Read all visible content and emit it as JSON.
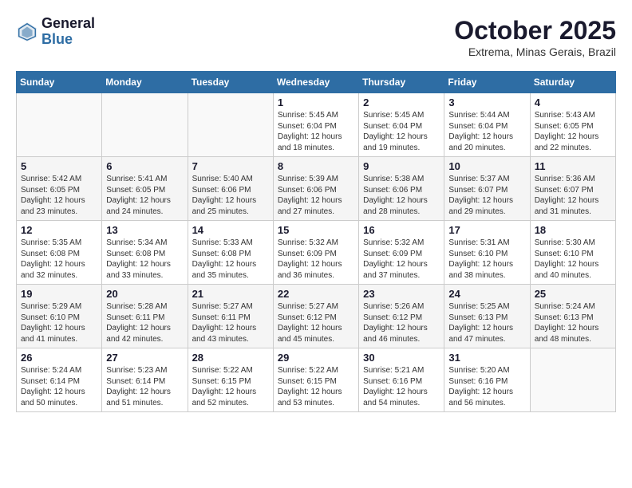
{
  "header": {
    "logo_line1": "General",
    "logo_line2": "Blue",
    "month": "October 2025",
    "location": "Extrema, Minas Gerais, Brazil"
  },
  "days_of_week": [
    "Sunday",
    "Monday",
    "Tuesday",
    "Wednesday",
    "Thursday",
    "Friday",
    "Saturday"
  ],
  "weeks": [
    [
      {
        "day": "",
        "info": ""
      },
      {
        "day": "",
        "info": ""
      },
      {
        "day": "",
        "info": ""
      },
      {
        "day": "1",
        "info": "Sunrise: 5:45 AM\nSunset: 6:04 PM\nDaylight: 12 hours\nand 18 minutes."
      },
      {
        "day": "2",
        "info": "Sunrise: 5:45 AM\nSunset: 6:04 PM\nDaylight: 12 hours\nand 19 minutes."
      },
      {
        "day": "3",
        "info": "Sunrise: 5:44 AM\nSunset: 6:04 PM\nDaylight: 12 hours\nand 20 minutes."
      },
      {
        "day": "4",
        "info": "Sunrise: 5:43 AM\nSunset: 6:05 PM\nDaylight: 12 hours\nand 22 minutes."
      }
    ],
    [
      {
        "day": "5",
        "info": "Sunrise: 5:42 AM\nSunset: 6:05 PM\nDaylight: 12 hours\nand 23 minutes."
      },
      {
        "day": "6",
        "info": "Sunrise: 5:41 AM\nSunset: 6:05 PM\nDaylight: 12 hours\nand 24 minutes."
      },
      {
        "day": "7",
        "info": "Sunrise: 5:40 AM\nSunset: 6:06 PM\nDaylight: 12 hours\nand 25 minutes."
      },
      {
        "day": "8",
        "info": "Sunrise: 5:39 AM\nSunset: 6:06 PM\nDaylight: 12 hours\nand 27 minutes."
      },
      {
        "day": "9",
        "info": "Sunrise: 5:38 AM\nSunset: 6:06 PM\nDaylight: 12 hours\nand 28 minutes."
      },
      {
        "day": "10",
        "info": "Sunrise: 5:37 AM\nSunset: 6:07 PM\nDaylight: 12 hours\nand 29 minutes."
      },
      {
        "day": "11",
        "info": "Sunrise: 5:36 AM\nSunset: 6:07 PM\nDaylight: 12 hours\nand 31 minutes."
      }
    ],
    [
      {
        "day": "12",
        "info": "Sunrise: 5:35 AM\nSunset: 6:08 PM\nDaylight: 12 hours\nand 32 minutes."
      },
      {
        "day": "13",
        "info": "Sunrise: 5:34 AM\nSunset: 6:08 PM\nDaylight: 12 hours\nand 33 minutes."
      },
      {
        "day": "14",
        "info": "Sunrise: 5:33 AM\nSunset: 6:08 PM\nDaylight: 12 hours\nand 35 minutes."
      },
      {
        "day": "15",
        "info": "Sunrise: 5:32 AM\nSunset: 6:09 PM\nDaylight: 12 hours\nand 36 minutes."
      },
      {
        "day": "16",
        "info": "Sunrise: 5:32 AM\nSunset: 6:09 PM\nDaylight: 12 hours\nand 37 minutes."
      },
      {
        "day": "17",
        "info": "Sunrise: 5:31 AM\nSunset: 6:10 PM\nDaylight: 12 hours\nand 38 minutes."
      },
      {
        "day": "18",
        "info": "Sunrise: 5:30 AM\nSunset: 6:10 PM\nDaylight: 12 hours\nand 40 minutes."
      }
    ],
    [
      {
        "day": "19",
        "info": "Sunrise: 5:29 AM\nSunset: 6:10 PM\nDaylight: 12 hours\nand 41 minutes."
      },
      {
        "day": "20",
        "info": "Sunrise: 5:28 AM\nSunset: 6:11 PM\nDaylight: 12 hours\nand 42 minutes."
      },
      {
        "day": "21",
        "info": "Sunrise: 5:27 AM\nSunset: 6:11 PM\nDaylight: 12 hours\nand 43 minutes."
      },
      {
        "day": "22",
        "info": "Sunrise: 5:27 AM\nSunset: 6:12 PM\nDaylight: 12 hours\nand 45 minutes."
      },
      {
        "day": "23",
        "info": "Sunrise: 5:26 AM\nSunset: 6:12 PM\nDaylight: 12 hours\nand 46 minutes."
      },
      {
        "day": "24",
        "info": "Sunrise: 5:25 AM\nSunset: 6:13 PM\nDaylight: 12 hours\nand 47 minutes."
      },
      {
        "day": "25",
        "info": "Sunrise: 5:24 AM\nSunset: 6:13 PM\nDaylight: 12 hours\nand 48 minutes."
      }
    ],
    [
      {
        "day": "26",
        "info": "Sunrise: 5:24 AM\nSunset: 6:14 PM\nDaylight: 12 hours\nand 50 minutes."
      },
      {
        "day": "27",
        "info": "Sunrise: 5:23 AM\nSunset: 6:14 PM\nDaylight: 12 hours\nand 51 minutes."
      },
      {
        "day": "28",
        "info": "Sunrise: 5:22 AM\nSunset: 6:15 PM\nDaylight: 12 hours\nand 52 minutes."
      },
      {
        "day": "29",
        "info": "Sunrise: 5:22 AM\nSunset: 6:15 PM\nDaylight: 12 hours\nand 53 minutes."
      },
      {
        "day": "30",
        "info": "Sunrise: 5:21 AM\nSunset: 6:16 PM\nDaylight: 12 hours\nand 54 minutes."
      },
      {
        "day": "31",
        "info": "Sunrise: 5:20 AM\nSunset: 6:16 PM\nDaylight: 12 hours\nand 56 minutes."
      },
      {
        "day": "",
        "info": ""
      }
    ]
  ]
}
